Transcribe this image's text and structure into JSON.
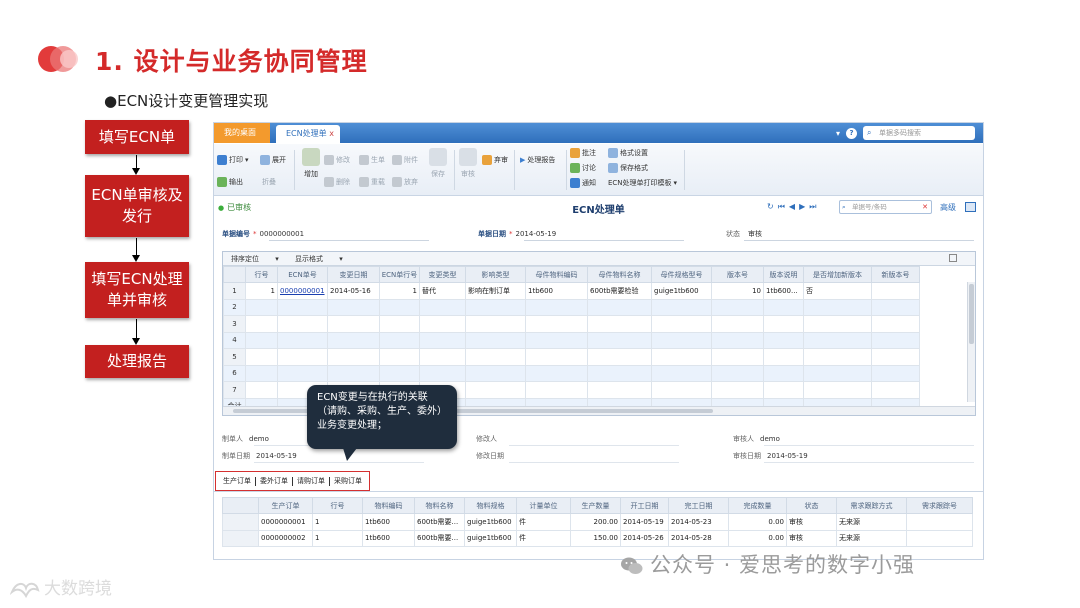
{
  "slide": {
    "title": "1. 设计与业务协同管理",
    "subtitle": "●ECN设计变更管理实现"
  },
  "flow": {
    "steps": [
      "填写ECN单",
      "ECN单审核及\n发行",
      "填写ECN处理\n单并审核",
      "处理报告"
    ]
  },
  "app": {
    "tabs": {
      "home": "我的桌面",
      "ecn": "ECN处理单",
      "close": "x"
    },
    "top_search_placeholder": "单据多码搜索",
    "help": "?",
    "toolbar": {
      "print": "打印",
      "expand": "展开",
      "add": "增加",
      "modify": "修改",
      "generate": "生单",
      "attach": "附件",
      "save": "保存",
      "audit": "审核",
      "abandon": "弃审",
      "report": "处理报告",
      "approve": "批注",
      "discuss": "讨论",
      "notify": "通知",
      "format_setting": "格式设置",
      "save_format": "保存格式",
      "print_template": "ECN处理单打印模板",
      "export": "输出",
      "collapse": "折叠",
      "delete": "删除",
      "redo": "重载",
      "abandon2": "放弃"
    },
    "status": "已审核",
    "form_title": "ECN处理单",
    "nav_search_placeholder": "单据号/条码",
    "advanced": "高级",
    "header": {
      "doc_no_label": "单据编号",
      "doc_no": "0000000001",
      "doc_date_label": "单据日期",
      "doc_date": "2014-05-19",
      "state_label": "状态",
      "state": "审核"
    },
    "grid_bar": {
      "sort": "排序定位",
      "display": "显示格式"
    },
    "grid_columns": [
      "",
      "行号",
      "ECN单号",
      "变更日期",
      "ECN单行号",
      "变更类型",
      "影响类型",
      "母件物料编码",
      "母件物料名称",
      "母件规格型号",
      "版本号",
      "版本说明",
      "是否增加新版本",
      "新版本号"
    ],
    "grid_rows": [
      [
        "1",
        "1",
        "0000000001",
        "2014-05-16",
        "1",
        "替代",
        "影响在制订单",
        "1tb600",
        "600tb需要检验",
        "guige1tb600",
        "10",
        "1tb600...",
        "否",
        ""
      ],
      [
        "2",
        "",
        "",
        "",
        "",
        "",
        "",
        "",
        "",
        "",
        "",
        "",
        "",
        ""
      ],
      [
        "3",
        "",
        "",
        "",
        "",
        "",
        "",
        "",
        "",
        "",
        "",
        "",
        "",
        ""
      ],
      [
        "4",
        "",
        "",
        "",
        "",
        "",
        "",
        "",
        "",
        "",
        "",
        "",
        "",
        ""
      ],
      [
        "5",
        "",
        "",
        "",
        "",
        "",
        "",
        "",
        "",
        "",
        "",
        "",
        "",
        ""
      ],
      [
        "6",
        "",
        "",
        "",
        "",
        "",
        "",
        "",
        "",
        "",
        "",
        "",
        "",
        ""
      ],
      [
        "7",
        "",
        "",
        "",
        "",
        "",
        "",
        "",
        "",
        "",
        "",
        "",
        "",
        ""
      ],
      [
        "合计",
        "",
        "",
        "",
        "",
        "",
        "",
        "",
        "",
        "",
        "",
        "",
        "",
        ""
      ]
    ],
    "footer": {
      "maker_label": "制单人",
      "maker": "demo",
      "modifier_label": "修改人",
      "modifier": "",
      "auditor_label": "审核人",
      "auditor": "demo",
      "make_date_label": "制单日期",
      "make_date": "2014-05-19",
      "modify_date_label": "修改日期",
      "modify_date": "",
      "audit_date_label": "审核日期",
      "audit_date": "2014-05-19"
    },
    "bottom_tabs": [
      "生产订单",
      "委外订单",
      "请购订单",
      "采购订单"
    ],
    "bottom_columns": [
      "",
      "生产订单",
      "行号",
      "物料编码",
      "物料名称",
      "物料规格",
      "计量单位",
      "生产数量",
      "开工日期",
      "完工日期",
      "完成数量",
      "状态",
      "需求跟踪方式",
      "需求跟踪号"
    ],
    "bottom_rows": [
      [
        "",
        "0000000001",
        "1",
        "1tb600",
        "600tb需要...",
        "guige1tb600",
        "件",
        "200.00",
        "2014-05-19",
        "2014-05-23",
        "0.00",
        "审核",
        "无来源",
        ""
      ],
      [
        "",
        "0000000002",
        "1",
        "1tb600",
        "600tb需要...",
        "guige1tb600",
        "件",
        "150.00",
        "2014-05-26",
        "2014-05-28",
        "0.00",
        "审核",
        "无来源",
        ""
      ]
    ]
  },
  "tooltip": "ECN变更与在执行的关联（请购、采购、生产、委外）业务变更处理；",
  "watermarks": {
    "right": "公众号 · 爱思考的数字小强",
    "left": "大数跨境"
  },
  "colors": {
    "title_red": "#d42a2a",
    "flow_red": "#c3201f",
    "tab_blue": "#2f6fbb",
    "home_tab_orange": "#f39a2d",
    "tooltip_bg": "#1f2d3d"
  }
}
